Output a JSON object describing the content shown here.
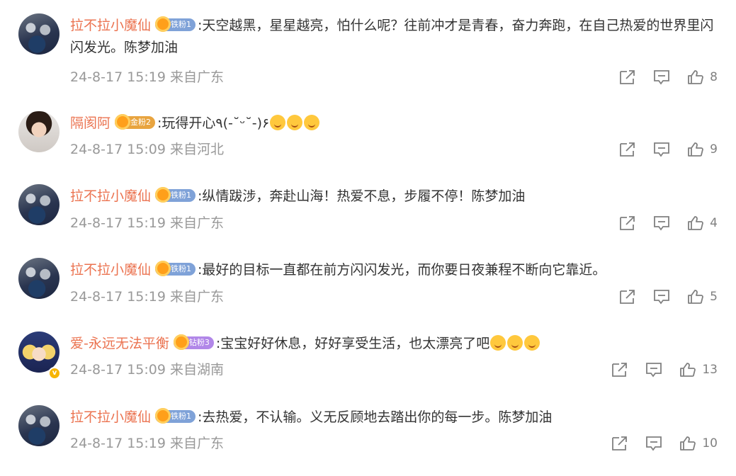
{
  "comments": [
    {
      "username": "拉不拉小魔仙",
      "badge": "铁粉1",
      "badge_type": "iron",
      "text": ":天空越黑，星星越亮，怕什么呢？往前冲才是青春，奋力奔跑，在自己热爱的世界里闪闪发光。陈梦加油",
      "emojis": [],
      "time": "24-8-17 15:19",
      "location": "来自广东",
      "likes": "8",
      "avatar": "crowd-avatar"
    },
    {
      "username": "隔阂阿",
      "badge": "金粉2",
      "badge_type": "gold",
      "text": ":玩得开心٩(-˘ᵕ˘-)۶",
      "emojis": [
        "emoji-hug",
        "emoji-hug",
        "emoji-hug"
      ],
      "time": "24-8-17 15:09",
      "location": "来自河北",
      "likes": "9",
      "avatar": "woman-avatar"
    },
    {
      "username": "拉不拉小魔仙",
      "badge": "铁粉1",
      "badge_type": "iron",
      "text": ":纵情跋涉，奔赴山海！热爱不息，步履不停！陈梦加油",
      "emojis": [],
      "time": "24-8-17 15:19",
      "location": "来自广东",
      "likes": "4",
      "avatar": "crowd-avatar"
    },
    {
      "username": "拉不拉小魔仙",
      "badge": "铁粉1",
      "badge_type": "iron",
      "text": ":最好的目标一直都在前方闪闪发光，而你要日夜兼程不断向它靠近。",
      "emojis": [],
      "time": "24-8-17 15:19",
      "location": "来自广东",
      "likes": "5",
      "avatar": "crowd-avatar"
    },
    {
      "username": "爱-永远无法平衡",
      "badge": "钻粉3",
      "badge_type": "diamond",
      "text": ":宝宝好好休息，好好享受生活，也太漂亮了吧",
      "emojis": [
        "emoji-heart-eyes",
        "emoji-heart-eyes",
        "emoji-heart-eyes"
      ],
      "time": "24-8-17 15:09",
      "location": "来自湖南",
      "likes": "13",
      "avatar": "anime-avatar"
    },
    {
      "username": "拉不拉小魔仙",
      "badge": "铁粉1",
      "badge_type": "iron",
      "text": ":去热爱，不认输。义无反顾地去踏出你的每一步。陈梦加油",
      "emojis": [],
      "time": "24-8-17 15:19",
      "location": "来自广东",
      "likes": "10",
      "avatar": "crowd-avatar"
    }
  ],
  "colors": {
    "username": "#eb7350",
    "meta": "#999999",
    "icon": "#808080"
  },
  "icons": [
    "share-icon",
    "comment-icon",
    "like-icon"
  ]
}
